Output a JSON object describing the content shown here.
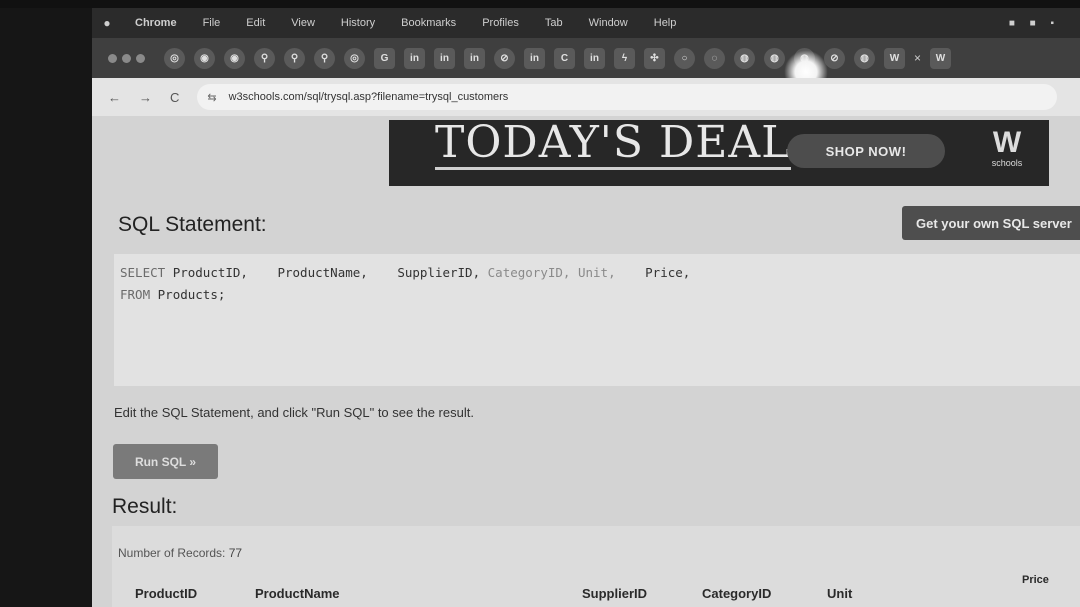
{
  "menubar": {
    "items": [
      "Chrome",
      "File",
      "Edit",
      "View",
      "History",
      "Bookmarks",
      "Profiles",
      "Tab",
      "Window",
      "Help"
    ]
  },
  "tabs": {
    "favicons": [
      "G",
      "in",
      "in",
      "in",
      "⊘",
      "in",
      "C",
      "in",
      "W",
      "W"
    ],
    "close": "×"
  },
  "toolbar": {
    "back": "←",
    "forward": "→",
    "reload": "C",
    "site_icon": "⇆",
    "url": "w3schools.com/sql/trysql.asp?filename=trysql_customers"
  },
  "ad": {
    "title": "TODAY'S DEAL",
    "button": "SHOP NOW!",
    "logo_mark": "W",
    "logo_text": "schools"
  },
  "sql": {
    "heading": "SQL Statement:",
    "get_server_button": "Get your own SQL server",
    "editor": {
      "kw_select": "SELECT",
      "col1": "ProductID,",
      "col2": "ProductName,",
      "col3": "SupplierID,",
      "col4": "CategoryID,",
      "col5": "Unit,",
      "col6": "Price,",
      "kw_from": "FROM",
      "table": "Products;"
    },
    "hint": "Edit the SQL Statement, and click \"Run SQL\" to see the result.",
    "run_button": "Run SQL »"
  },
  "result": {
    "heading": "Result:",
    "records_label": "Number of Records:",
    "records_count": "77",
    "columns": [
      "ProductID",
      "ProductName",
      "SupplierID",
      "CategoryID",
      "Unit",
      "Price"
    ]
  },
  "colors": {
    "ad_bg": "#272727",
    "button_bg": "#4e4e4e",
    "page_bg": "#d3d3d3"
  }
}
